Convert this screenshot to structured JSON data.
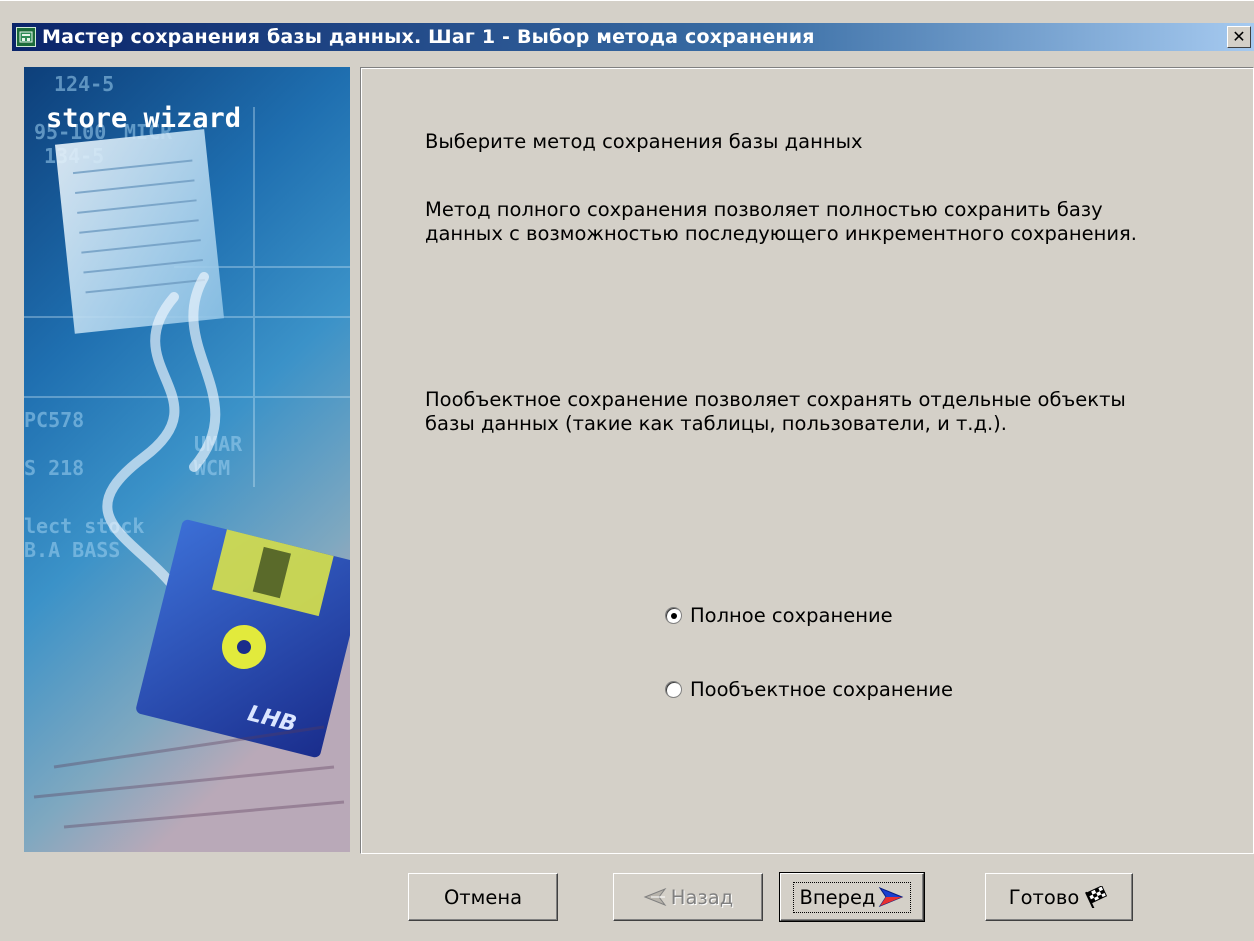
{
  "window": {
    "title": "Мастер сохранения базы данных. Шаг 1 - Выбор метода сохранения",
    "close_glyph": "✕"
  },
  "image_panel": {
    "logo_text": "store wizard",
    "decor_texts": [
      "124-5",
      "95-100",
      "MICR",
      "134-5",
      "PC578",
      "UMAR",
      "WCM",
      "S 218",
      "lect stock",
      "B.A BASS",
      "LHB"
    ]
  },
  "content": {
    "prompt": "Выберите метод сохранения базы данных",
    "full_description": "Метод полного сохранения позволяет полностью сохранить базу\nданных с возможностью последующего инкрементного сохранения.",
    "object_description": "Пообъектное сохранение позволяет сохранять отдельные объекты\nбазы данных (такие как таблицы, пользователи, и т.д.).",
    "options": [
      {
        "label": "Полное сохранение",
        "selected": true
      },
      {
        "label": "Пообъектное сохранение",
        "selected": false
      }
    ]
  },
  "buttons": {
    "cancel": "Отмена",
    "back": "Назад",
    "next": "Вперед",
    "finish": "Готово"
  },
  "colors": {
    "titlebar_start": "#0a246a",
    "titlebar_end": "#a6caf0",
    "dialog_face": "#d4d0c8"
  },
  "icons": {
    "back": "back-arrow-icon",
    "next": "next-arrow-icon",
    "finish": "checkered-flag-icon",
    "app": "app-icon"
  }
}
